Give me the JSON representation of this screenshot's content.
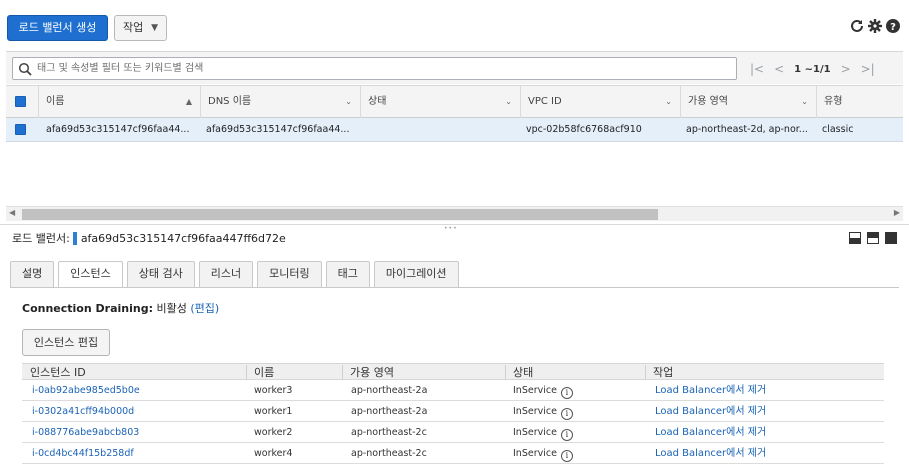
{
  "toolbar": {
    "create_label": "로드 밸런서 생성",
    "actions_label": "작업",
    "icons": [
      "refresh-icon",
      "gear-icon",
      "help-icon"
    ]
  },
  "filter": {
    "placeholder": "태그 및 속성별 필터 또는 키워드별 검색",
    "page_count": "1 ~1/1"
  },
  "grid": {
    "columns": [
      "이름",
      "DNS 이름",
      "상태",
      "VPC ID",
      "가용 영역",
      "유형"
    ],
    "rows": [
      {
        "name": "afa69d53c315147cf96faa44...",
        "dns": "afa69d53c315147cf96faa44...",
        "state": "",
        "vpc": "vpc-02b58fc6768acf910",
        "az": "ap-northeast-2d, ap-nor...",
        "type": "classic"
      }
    ]
  },
  "detail": {
    "label": "로드 밸런서:",
    "lb_name": "afa69d53c315147cf96faa447ff6d72e",
    "tabs": [
      "설명",
      "인스턴스",
      "상태 검사",
      "리스너",
      "모니터링",
      "태그",
      "마이그레이션"
    ],
    "active_tab": "인스턴스",
    "draining_label": "Connection Draining:",
    "draining_value": "비활성",
    "draining_edit": "(편집)",
    "edit_button": "인스턴스 편집",
    "instance_columns": [
      "인스턴스 ID",
      "이름",
      "가용 영역",
      "상태",
      "작업"
    ],
    "instances": [
      {
        "id": "i-0ab92abe985ed5b0e",
        "name": "worker3",
        "az": "ap-northeast-2a",
        "status": "InService",
        "action": "Load Balancer에서 제거"
      },
      {
        "id": "i-0302a41cff94b000d",
        "name": "worker1",
        "az": "ap-northeast-2a",
        "status": "InService",
        "action": "Load Balancer에서 제거"
      },
      {
        "id": "i-088776abe9abcb803",
        "name": "worker2",
        "az": "ap-northeast-2c",
        "status": "InService",
        "action": "Load Balancer에서 제거"
      },
      {
        "id": "i-0cd4bc44f15b258df",
        "name": "worker4",
        "az": "ap-northeast-2c",
        "status": "InService",
        "action": "Load Balancer에서 제거"
      }
    ]
  },
  "colors": {
    "primary": "#1e6fcf",
    "link": "#1a63b6",
    "selected_row": "#e4effa"
  }
}
